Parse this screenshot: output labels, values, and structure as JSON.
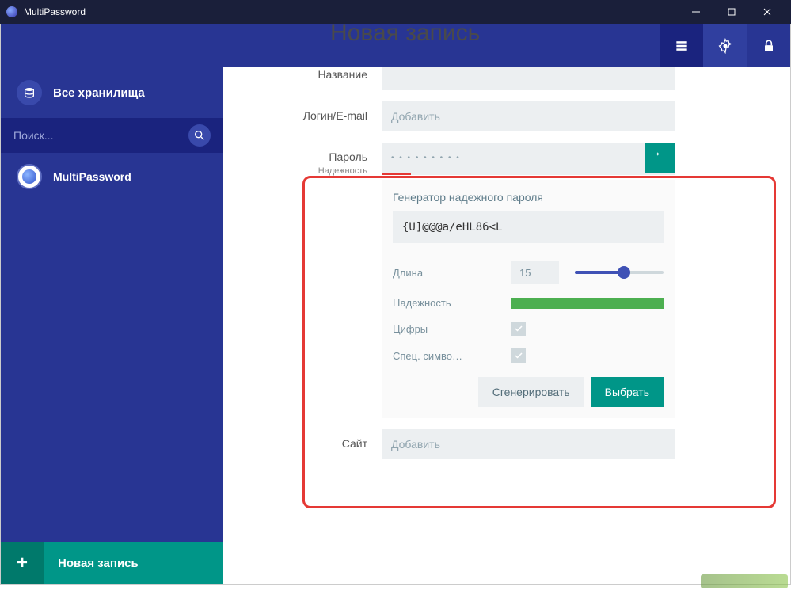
{
  "titlebar": {
    "app_name": "MultiPassword"
  },
  "topbar": {},
  "sidebar": {
    "all_vaults": "Все хранилища",
    "search_placeholder": "Поиск...",
    "vault_item": "MultiPassword",
    "new_entry": "Новая запись"
  },
  "page": {
    "title": "Новая запись"
  },
  "form": {
    "name_label": "Название",
    "login_label": "Логин/E-mail",
    "login_placeholder": "Добавить",
    "password_label": "Пароль",
    "password_masked": "• • • • • • • • •",
    "strength_label": "Надежность",
    "site_label": "Сайт",
    "site_placeholder": "Добавить"
  },
  "generator": {
    "title": "Генератор надежного пароля",
    "output": "{U]@@@a/eHL86<L",
    "length_label": "Длина",
    "length_value": "15",
    "slider_percent": 55,
    "strength_label": "Надежность",
    "digits_label": "Цифры",
    "special_label": "Спец. симво…",
    "generate": "Сгенерировать",
    "choose": "Выбрать"
  }
}
